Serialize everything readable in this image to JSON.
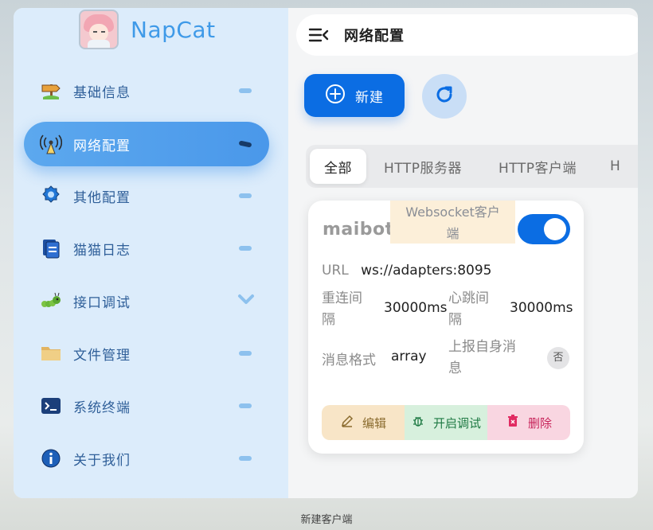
{
  "app": {
    "brand": "NapCat"
  },
  "sidebar": {
    "items": [
      {
        "label": "基础信息",
        "icon": "signpost-icon"
      },
      {
        "label": "网络配置",
        "icon": "antenna-icon",
        "active": true
      },
      {
        "label": "其他配置",
        "icon": "gear-icon"
      },
      {
        "label": "猫猫日志",
        "icon": "document-icon"
      },
      {
        "label": "接口调试",
        "icon": "caterpillar-icon"
      },
      {
        "label": "文件管理",
        "icon": "folder-icon"
      },
      {
        "label": "系统终端",
        "icon": "terminal-icon"
      },
      {
        "label": "关于我们",
        "icon": "info-icon"
      }
    ]
  },
  "header": {
    "title": "网络配置"
  },
  "toolbar": {
    "new_label": "新建"
  },
  "tabs": [
    {
      "label": "全部",
      "active": true
    },
    {
      "label": "HTTP服务器"
    },
    {
      "label": "HTTP客户端"
    },
    {
      "label": "H"
    }
  ],
  "card": {
    "name": "maibot",
    "type_line1": "Websocket客户",
    "type_line2": "端",
    "enabled": true,
    "url_label": "URL",
    "url_value": "ws://adapters:8095",
    "reconnect_label_1": "重连间",
    "reconnect_label_2": "隔",
    "reconnect_value": "30000ms",
    "heartbeat_label_1": "心跳间",
    "heartbeat_label_2": "隔",
    "heartbeat_value": "30000ms",
    "format_label": "消息格式",
    "format_value": "array",
    "report_self_label_1": "上报自身消",
    "report_self_label_2": "息",
    "report_self_value": "否",
    "actions": {
      "edit": "编辑",
      "debug": "开启调试",
      "delete": "删除"
    }
  },
  "caption": "新建客户端",
  "colors": {
    "primary": "#0b6de3",
    "sidebar_bg": "#dcecfb",
    "brand": "#3f9ae8"
  }
}
